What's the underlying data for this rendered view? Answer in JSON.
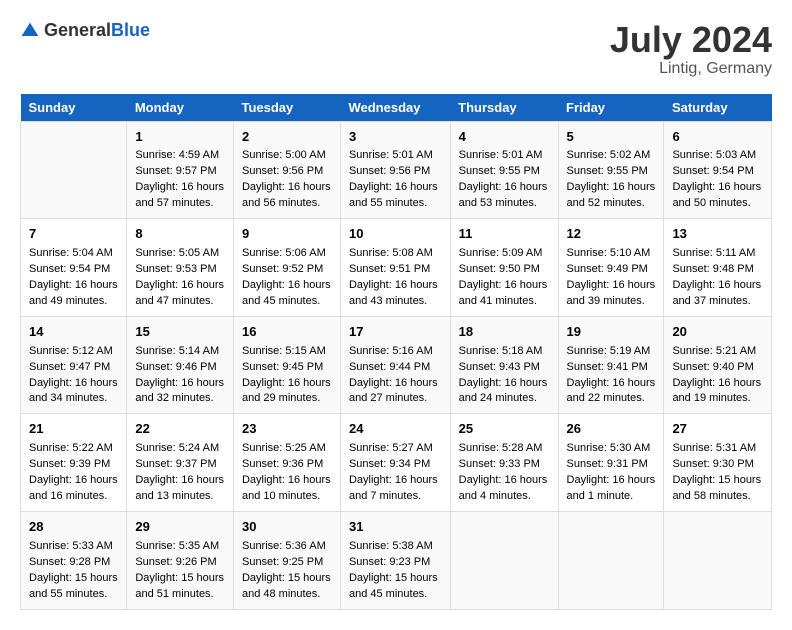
{
  "header": {
    "logo_general": "General",
    "logo_blue": "Blue",
    "month_year": "July 2024",
    "location": "Lintig, Germany"
  },
  "columns": [
    "Sunday",
    "Monday",
    "Tuesday",
    "Wednesday",
    "Thursday",
    "Friday",
    "Saturday"
  ],
  "weeks": [
    [
      {
        "day": "",
        "info": ""
      },
      {
        "day": "1",
        "info": "Sunrise: 4:59 AM\nSunset: 9:57 PM\nDaylight: 16 hours and 57 minutes."
      },
      {
        "day": "2",
        "info": "Sunrise: 5:00 AM\nSunset: 9:56 PM\nDaylight: 16 hours and 56 minutes."
      },
      {
        "day": "3",
        "info": "Sunrise: 5:01 AM\nSunset: 9:56 PM\nDaylight: 16 hours and 55 minutes."
      },
      {
        "day": "4",
        "info": "Sunrise: 5:01 AM\nSunset: 9:55 PM\nDaylight: 16 hours and 53 minutes."
      },
      {
        "day": "5",
        "info": "Sunrise: 5:02 AM\nSunset: 9:55 PM\nDaylight: 16 hours and 52 minutes."
      },
      {
        "day": "6",
        "info": "Sunrise: 5:03 AM\nSunset: 9:54 PM\nDaylight: 16 hours and 50 minutes."
      }
    ],
    [
      {
        "day": "7",
        "info": "Sunrise: 5:04 AM\nSunset: 9:54 PM\nDaylight: 16 hours and 49 minutes."
      },
      {
        "day": "8",
        "info": "Sunrise: 5:05 AM\nSunset: 9:53 PM\nDaylight: 16 hours and 47 minutes."
      },
      {
        "day": "9",
        "info": "Sunrise: 5:06 AM\nSunset: 9:52 PM\nDaylight: 16 hours and 45 minutes."
      },
      {
        "day": "10",
        "info": "Sunrise: 5:08 AM\nSunset: 9:51 PM\nDaylight: 16 hours and 43 minutes."
      },
      {
        "day": "11",
        "info": "Sunrise: 5:09 AM\nSunset: 9:50 PM\nDaylight: 16 hours and 41 minutes."
      },
      {
        "day": "12",
        "info": "Sunrise: 5:10 AM\nSunset: 9:49 PM\nDaylight: 16 hours and 39 minutes."
      },
      {
        "day": "13",
        "info": "Sunrise: 5:11 AM\nSunset: 9:48 PM\nDaylight: 16 hours and 37 minutes."
      }
    ],
    [
      {
        "day": "14",
        "info": "Sunrise: 5:12 AM\nSunset: 9:47 PM\nDaylight: 16 hours and 34 minutes."
      },
      {
        "day": "15",
        "info": "Sunrise: 5:14 AM\nSunset: 9:46 PM\nDaylight: 16 hours and 32 minutes."
      },
      {
        "day": "16",
        "info": "Sunrise: 5:15 AM\nSunset: 9:45 PM\nDaylight: 16 hours and 29 minutes."
      },
      {
        "day": "17",
        "info": "Sunrise: 5:16 AM\nSunset: 9:44 PM\nDaylight: 16 hours and 27 minutes."
      },
      {
        "day": "18",
        "info": "Sunrise: 5:18 AM\nSunset: 9:43 PM\nDaylight: 16 hours and 24 minutes."
      },
      {
        "day": "19",
        "info": "Sunrise: 5:19 AM\nSunset: 9:41 PM\nDaylight: 16 hours and 22 minutes."
      },
      {
        "day": "20",
        "info": "Sunrise: 5:21 AM\nSunset: 9:40 PM\nDaylight: 16 hours and 19 minutes."
      }
    ],
    [
      {
        "day": "21",
        "info": "Sunrise: 5:22 AM\nSunset: 9:39 PM\nDaylight: 16 hours and 16 minutes."
      },
      {
        "day": "22",
        "info": "Sunrise: 5:24 AM\nSunset: 9:37 PM\nDaylight: 16 hours and 13 minutes."
      },
      {
        "day": "23",
        "info": "Sunrise: 5:25 AM\nSunset: 9:36 PM\nDaylight: 16 hours and 10 minutes."
      },
      {
        "day": "24",
        "info": "Sunrise: 5:27 AM\nSunset: 9:34 PM\nDaylight: 16 hours and 7 minutes."
      },
      {
        "day": "25",
        "info": "Sunrise: 5:28 AM\nSunset: 9:33 PM\nDaylight: 16 hours and 4 minutes."
      },
      {
        "day": "26",
        "info": "Sunrise: 5:30 AM\nSunset: 9:31 PM\nDaylight: 16 hours and 1 minute."
      },
      {
        "day": "27",
        "info": "Sunrise: 5:31 AM\nSunset: 9:30 PM\nDaylight: 15 hours and 58 minutes."
      }
    ],
    [
      {
        "day": "28",
        "info": "Sunrise: 5:33 AM\nSunset: 9:28 PM\nDaylight: 15 hours and 55 minutes."
      },
      {
        "day": "29",
        "info": "Sunrise: 5:35 AM\nSunset: 9:26 PM\nDaylight: 15 hours and 51 minutes."
      },
      {
        "day": "30",
        "info": "Sunrise: 5:36 AM\nSunset: 9:25 PM\nDaylight: 15 hours and 48 minutes."
      },
      {
        "day": "31",
        "info": "Sunrise: 5:38 AM\nSunset: 9:23 PM\nDaylight: 15 hours and 45 minutes."
      },
      {
        "day": "",
        "info": ""
      },
      {
        "day": "",
        "info": ""
      },
      {
        "day": "",
        "info": ""
      }
    ]
  ]
}
